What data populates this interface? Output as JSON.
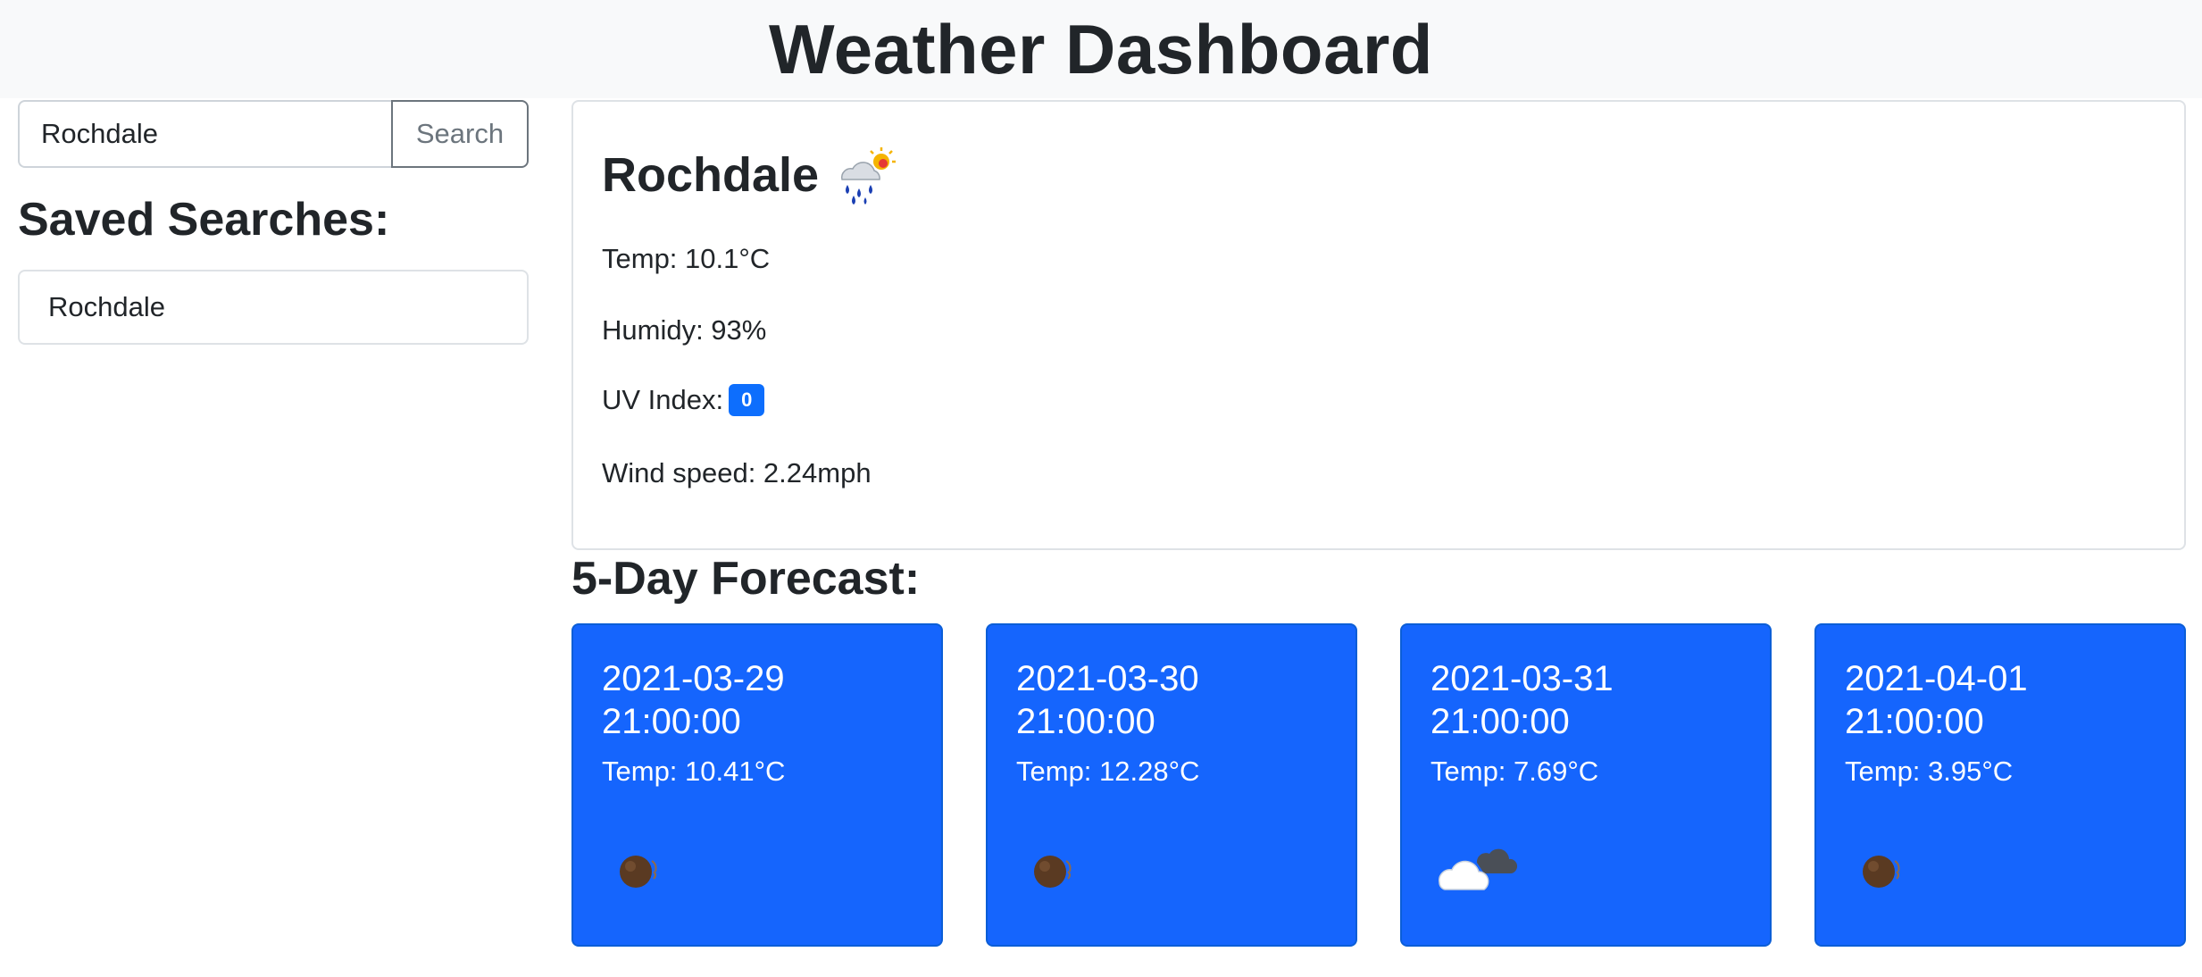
{
  "header": {
    "title": "Weather Dashboard"
  },
  "search": {
    "value": "Rochdale",
    "button_label": "Search"
  },
  "saved": {
    "title": "Saved Searches:",
    "items": [
      {
        "label": "Rochdale"
      }
    ]
  },
  "current": {
    "city": "Rochdale",
    "icon": "rain-sun-icon",
    "temp_label": "Temp: 10.1°C",
    "humidity_label": "Humidy: 93%",
    "uv_label": "UV Index:",
    "uv_value": "0",
    "uv_color": "#0d6efd",
    "wind_label": "Wind speed: 2.24mph"
  },
  "forecast": {
    "title": "5-Day Forecast:",
    "card_color": "#1565fd",
    "days": [
      {
        "date": "2021-03-29",
        "time": "21:00:00",
        "temp": "Temp: 10.41°C",
        "icon": "night-moon-icon"
      },
      {
        "date": "2021-03-30",
        "time": "21:00:00",
        "temp": "Temp: 12.28°C",
        "icon": "night-moon-icon"
      },
      {
        "date": "2021-03-31",
        "time": "21:00:00",
        "temp": "Temp: 7.69°C",
        "icon": "cloud-icon"
      },
      {
        "date": "2021-04-01",
        "time": "21:00:00",
        "temp": "Temp: 3.95°C",
        "icon": "night-moon-icon"
      }
    ]
  }
}
